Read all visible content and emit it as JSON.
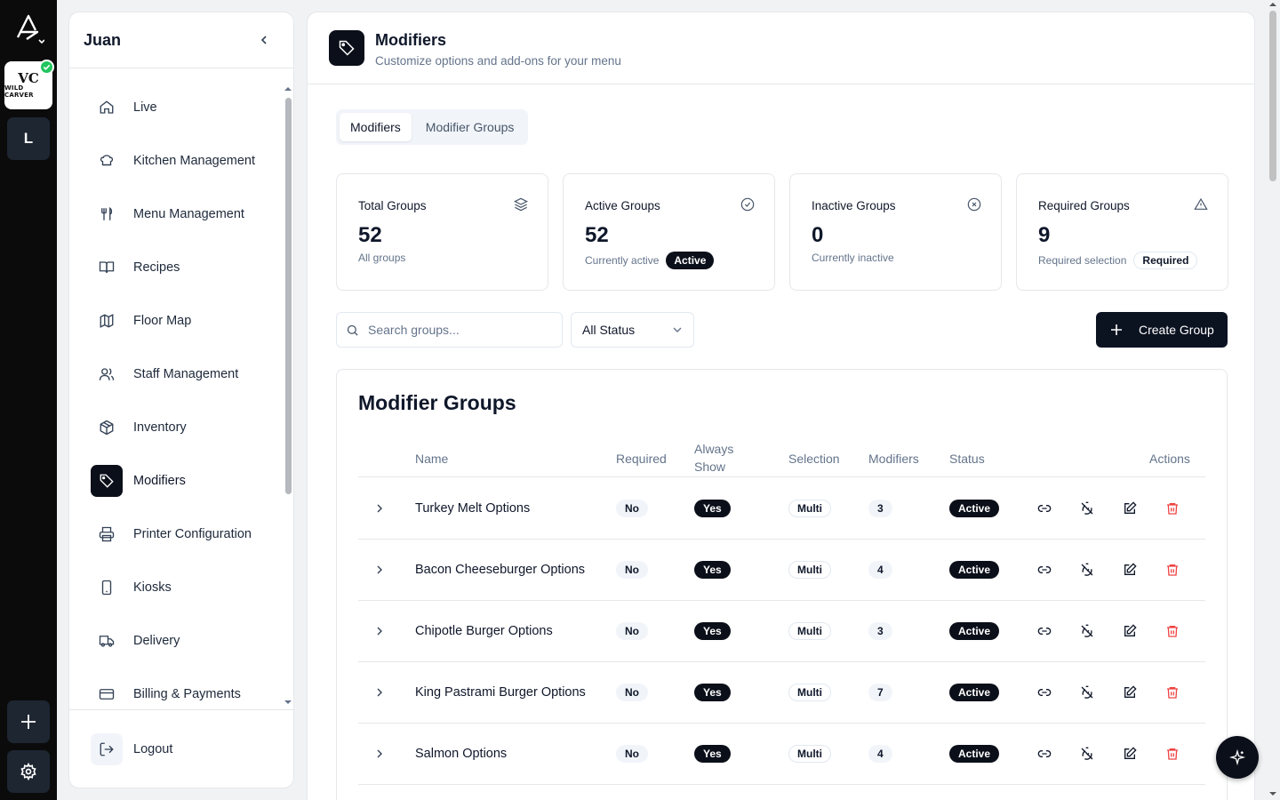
{
  "rail": {
    "brand_icon": "brand-a-logo",
    "logo_line1": "VC",
    "logo_line2": "WILD CARVER",
    "workspace_initial": "L"
  },
  "sidebar": {
    "user_name": "Juan",
    "items": [
      {
        "label": "Live",
        "icon": "home-icon"
      },
      {
        "label": "Kitchen Management",
        "icon": "chef-hat-icon"
      },
      {
        "label": "Menu Management",
        "icon": "utensils-icon"
      },
      {
        "label": "Recipes",
        "icon": "book-open-icon"
      },
      {
        "label": "Floor Map",
        "icon": "map-icon"
      },
      {
        "label": "Staff Management",
        "icon": "users-icon"
      },
      {
        "label": "Inventory",
        "icon": "package-icon"
      },
      {
        "label": "Modifiers",
        "icon": "tag-icon",
        "active": true
      },
      {
        "label": "Printer Configuration",
        "icon": "printer-icon"
      },
      {
        "label": "Kiosks",
        "icon": "tablet-icon"
      },
      {
        "label": "Delivery",
        "icon": "truck-icon"
      },
      {
        "label": "Billing & Payments",
        "icon": "credit-card-icon"
      }
    ],
    "logout_label": "Logout"
  },
  "header": {
    "title": "Modifiers",
    "subtitle": "Customize options and add-ons for your menu"
  },
  "tabs": [
    {
      "label": "Modifiers",
      "selected": true
    },
    {
      "label": "Modifier Groups",
      "selected": false
    }
  ],
  "stats": [
    {
      "title": "Total Groups",
      "value": "52",
      "desc": "All groups",
      "badge": "",
      "icon": "layers-icon"
    },
    {
      "title": "Active Groups",
      "value": "52",
      "desc": "Currently active",
      "badge": "Active",
      "icon": "check-circle-icon"
    },
    {
      "title": "Inactive Groups",
      "value": "0",
      "desc": "Currently inactive",
      "badge": "",
      "icon": "x-circle-icon"
    },
    {
      "title": "Required Groups",
      "value": "9",
      "desc": "Required selection",
      "badge": "Required",
      "icon": "alert-triangle-icon"
    }
  ],
  "filters": {
    "search_placeholder": "Search groups...",
    "status_selected": "All Status",
    "create_label": "Create Group"
  },
  "table": {
    "title": "Modifier Groups",
    "headers": {
      "name": "Name",
      "required": "Required",
      "always_show_1": "Always",
      "always_show_2": "Show",
      "selection": "Selection",
      "modifiers": "Modifiers",
      "status": "Status",
      "actions": "Actions"
    },
    "rows": [
      {
        "name": "Turkey Melt Options",
        "required": "No",
        "always_show": "Yes",
        "selection": "Multi",
        "modifiers": "3",
        "status": "Active"
      },
      {
        "name": "Bacon Cheeseburger Options",
        "required": "No",
        "always_show": "Yes",
        "selection": "Multi",
        "modifiers": "4",
        "status": "Active"
      },
      {
        "name": "Chipotle Burger Options",
        "required": "No",
        "always_show": "Yes",
        "selection": "Multi",
        "modifiers": "3",
        "status": "Active"
      },
      {
        "name": "King Pastrami Burger Options",
        "required": "No",
        "always_show": "Yes",
        "selection": "Multi",
        "modifiers": "7",
        "status": "Active"
      },
      {
        "name": "Salmon Options",
        "required": "No",
        "always_show": "Yes",
        "selection": "Multi",
        "modifiers": "4",
        "status": "Active"
      }
    ]
  },
  "colors": {
    "accent": "#0b0f19",
    "danger": "#ef4444",
    "success": "#22c55e"
  }
}
